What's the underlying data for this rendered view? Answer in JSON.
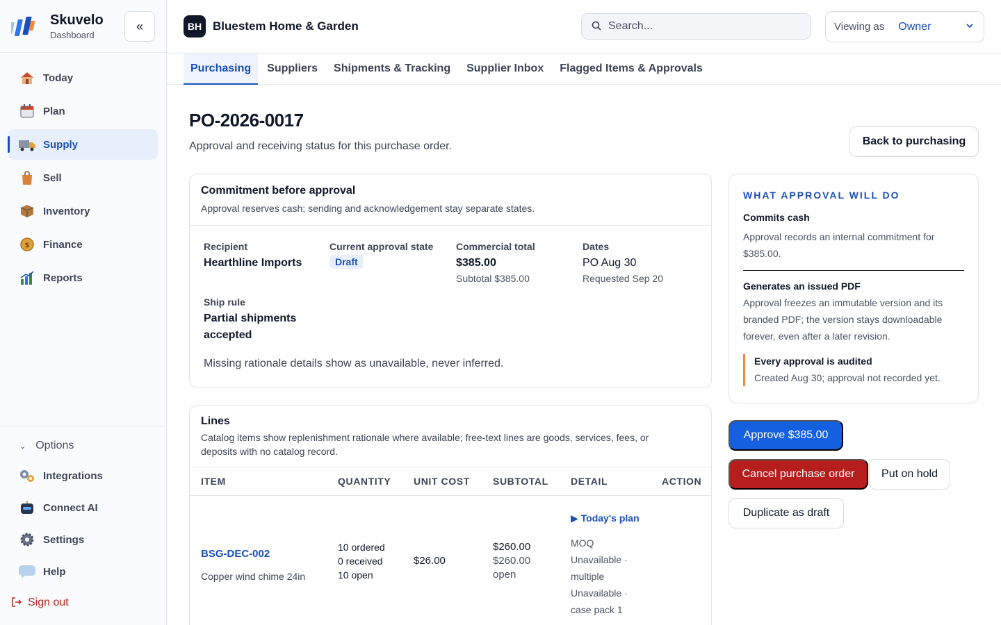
{
  "brand": {
    "name": "Skuvelo",
    "subtitle": "Dashboard"
  },
  "sidebar": {
    "collapse_icon": "double-chevron-left-icon",
    "items": [
      {
        "label": "Today",
        "icon": "house-icon"
      },
      {
        "label": "Plan",
        "icon": "calendar-icon"
      },
      {
        "label": "Supply",
        "icon": "truck-icon",
        "active": true
      },
      {
        "label": "Sell",
        "icon": "shopping-bag-icon"
      },
      {
        "label": "Inventory",
        "icon": "box-icon"
      },
      {
        "label": "Finance",
        "icon": "coin-icon"
      },
      {
        "label": "Reports",
        "icon": "chart-icon"
      }
    ],
    "options_label": "Options",
    "bottom_items": [
      {
        "label": "Integrations",
        "icon": "gears-icon"
      },
      {
        "label": "Connect AI",
        "icon": "robot-icon"
      },
      {
        "label": "Settings",
        "icon": "gear-icon"
      },
      {
        "label": "Help",
        "icon": "speech-bubble-icon"
      }
    ],
    "sign_out": "Sign out"
  },
  "header": {
    "org_initials": "BH",
    "org_name": "Bluestem Home & Garden",
    "search_placeholder": "Search...",
    "viewing_label": "Viewing as",
    "viewing_value": "Owner"
  },
  "tabs": [
    {
      "label": "Purchasing",
      "active": true
    },
    {
      "label": "Suppliers"
    },
    {
      "label": "Shipments & Tracking"
    },
    {
      "label": "Supplier Inbox"
    },
    {
      "label": "Flagged Items & Approvals"
    }
  ],
  "page": {
    "title": "PO-2026-0017",
    "subtitle": "Approval and receiving status for this purchase order.",
    "back_label": "Back to purchasing"
  },
  "commitment": {
    "title": "Commitment before approval",
    "description": "Approval reserves cash; sending and acknowledgement stay separate states.",
    "recipient_label": "Recipient",
    "recipient_value": "Hearthline Imports",
    "state_label": "Current approval state",
    "state_value": "Draft",
    "total_label": "Commercial total",
    "total_value": "$385.00",
    "total_meta": "Subtotal $385.00",
    "dates_label": "Dates",
    "dates_value": "PO Aug 30",
    "dates_meta": "Requested Sep 20",
    "ship_label": "Ship rule",
    "ship_value_1": "Partial shipments",
    "ship_value_2": "accepted",
    "missing_note": "Missing rationale details show as unavailable, never inferred."
  },
  "lines": {
    "title": "Lines",
    "description_1": "Catalog items show replenishment rationale where available; free-text lines are goods, services, fees, or",
    "description_2": "deposits with no catalog record.",
    "columns": [
      "ITEM",
      "QUANTITY",
      "UNIT COST",
      "SUBTOTAL",
      "DETAIL",
      "ACTION"
    ],
    "rows": [
      {
        "sku": "BSG-DEC-002",
        "name": "Copper wind chime 24in",
        "qty_ordered": "10 ordered",
        "qty_received": "0 received",
        "qty_open": "10 open",
        "unit_cost": "$26.00",
        "subtotal": "$260.00",
        "subtotal_open_1": "$260.00",
        "subtotal_open_2": "open",
        "plan_link": "▶ Today's plan",
        "detail_1": "MOQ",
        "detail_2": "Unavailable ·",
        "detail_3": "multiple",
        "detail_4": "Unavailable ·",
        "detail_5": "case pack 1"
      }
    ]
  },
  "approval": {
    "heading": "WHAT APPROVAL WILL DO",
    "cash_title": "Commits cash",
    "cash_body_1": "Approval records an internal commitment for",
    "cash_body_2": "$385.00.",
    "pdf_title": "Generates an issued PDF",
    "pdf_body_1": "Approval freezes an immutable version and its",
    "pdf_body_2": "branded PDF; the version stays downloadable",
    "pdf_body_3": "forever, even after a later revision.",
    "audit_title": "Every approval is audited",
    "audit_body": "Created Aug 30; approval not recorded yet."
  },
  "actions": {
    "approve": "Approve $385.00",
    "cancel": "Cancel purchase order",
    "hold": "Put on hold",
    "duplicate": "Duplicate as draft"
  },
  "colors": {
    "accent": "#1a4fb8",
    "primary_button": "#1560e0",
    "danger": "#b61d1d",
    "audit_bar": "#f0883e"
  }
}
